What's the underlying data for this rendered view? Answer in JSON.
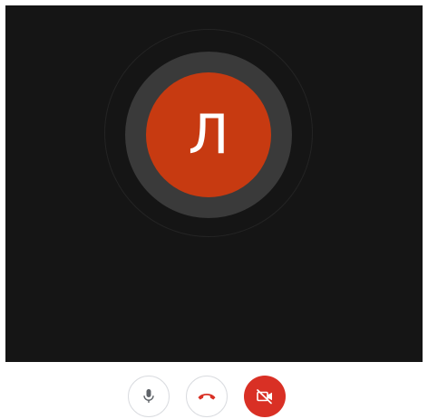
{
  "call": {
    "participant_initial": "Л",
    "avatar_color": "#c73a11",
    "background_color": "#151515"
  },
  "controls": {
    "mic": {
      "icon": "microphone-icon",
      "state": "on"
    },
    "hangup": {
      "icon": "phone-hangup-icon",
      "color": "#d93025"
    },
    "camera": {
      "icon": "camera-off-icon",
      "state": "off",
      "color": "#d93025"
    }
  }
}
